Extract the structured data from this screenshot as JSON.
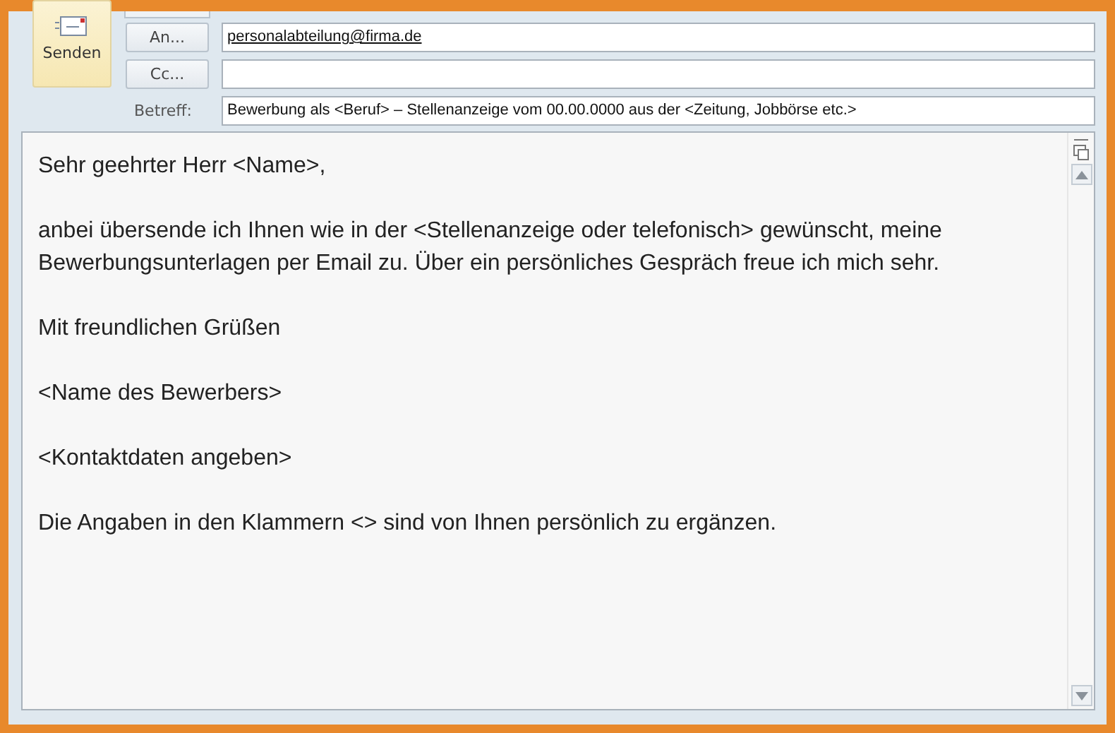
{
  "send_button": {
    "label": "Senden"
  },
  "recipients": [
    {
      "button": "An...",
      "value": "personalabteilung@firma.de"
    },
    {
      "button": "Cc..."
    }
  ],
  "subject": {
    "label": "Betreff:",
    "value": "Bewerbung als <Beruf> – Stellenanzeige vom 00.00.0000 aus der <Zeitung, Jobbörse etc.>"
  },
  "body": {
    "paragraphs": [
      "Sehr geehrter Herr <Name>,",
      "anbei übersende ich Ihnen wie in der <Stellenanzeige oder telefonisch> gewünscht, meine Bewerbungsunterlagen per Email zu. Über ein persönliches Gespräch freue ich mich sehr.",
      "Mit freundlichen Grüßen",
      "<Name des Bewerbers>",
      "<Kontaktdaten angeben>",
      "Die Angaben in den Klammern <> sind von Ihnen persönlich zu ergänzen."
    ]
  }
}
